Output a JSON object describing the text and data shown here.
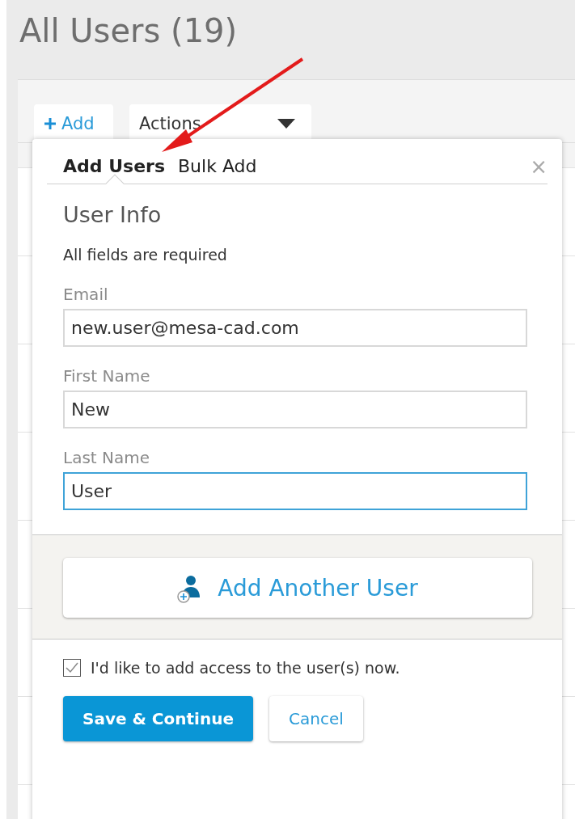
{
  "page": {
    "title": "All Users (19)"
  },
  "toolbar": {
    "add_button": {
      "label": "Add"
    },
    "actions_dropdown": {
      "label": "Actions"
    }
  },
  "dialog": {
    "tabs": [
      {
        "label": "Add Users",
        "selected": true
      },
      {
        "label": "Bulk Add",
        "selected": false
      }
    ],
    "close": "×",
    "section_title": "User Info",
    "note": "All fields are required",
    "fields": [
      {
        "label": "Email",
        "value": "new.user@mesa-cad.com",
        "focused": false
      },
      {
        "label": "First Name",
        "value": "New",
        "focused": false
      },
      {
        "label": "Last Name",
        "value": "User",
        "focused": true
      }
    ],
    "add_another": "Add Another User",
    "access_checkbox": {
      "label": "I'd like to add access to the user(s) now.",
      "checked": true
    },
    "buttons": [
      {
        "label": "Save & Continue",
        "kind": "primary"
      },
      {
        "label": "Cancel",
        "kind": "secondary"
      }
    ]
  }
}
